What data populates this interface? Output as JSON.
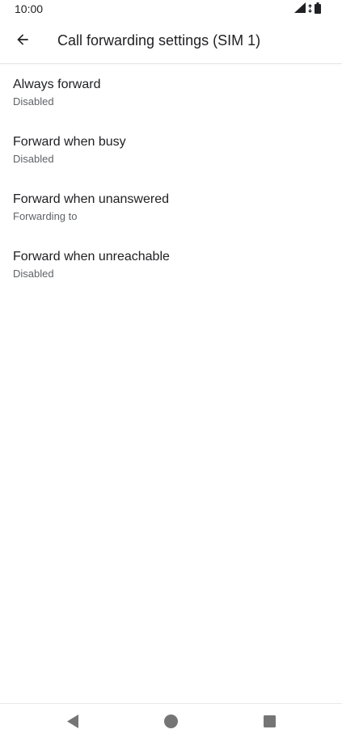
{
  "status_bar": {
    "time": "10:00",
    "icons": [
      "signal-icon",
      "data-arrows-icon",
      "battery-icon"
    ]
  },
  "app_bar": {
    "back_icon": "arrow-back-icon",
    "title": "Call forwarding settings (SIM 1)"
  },
  "settings": {
    "items": [
      {
        "title": "Always forward",
        "summary": "Disabled"
      },
      {
        "title": "Forward when busy",
        "summary": "Disabled"
      },
      {
        "title": "Forward when unanswered",
        "summary": "Forwarding to"
      },
      {
        "title": "Forward when unreachable",
        "summary": "Disabled"
      }
    ]
  },
  "nav_bar": {
    "icons": [
      "nav-back-triangle-icon",
      "nav-home-circle-icon",
      "nav-recents-square-icon"
    ]
  },
  "colors": {
    "text_primary": "#202124",
    "text_secondary": "#5f6368",
    "icon_dark": "#202124",
    "nav_icon": "#757575",
    "divider": "#e8e8e8"
  }
}
